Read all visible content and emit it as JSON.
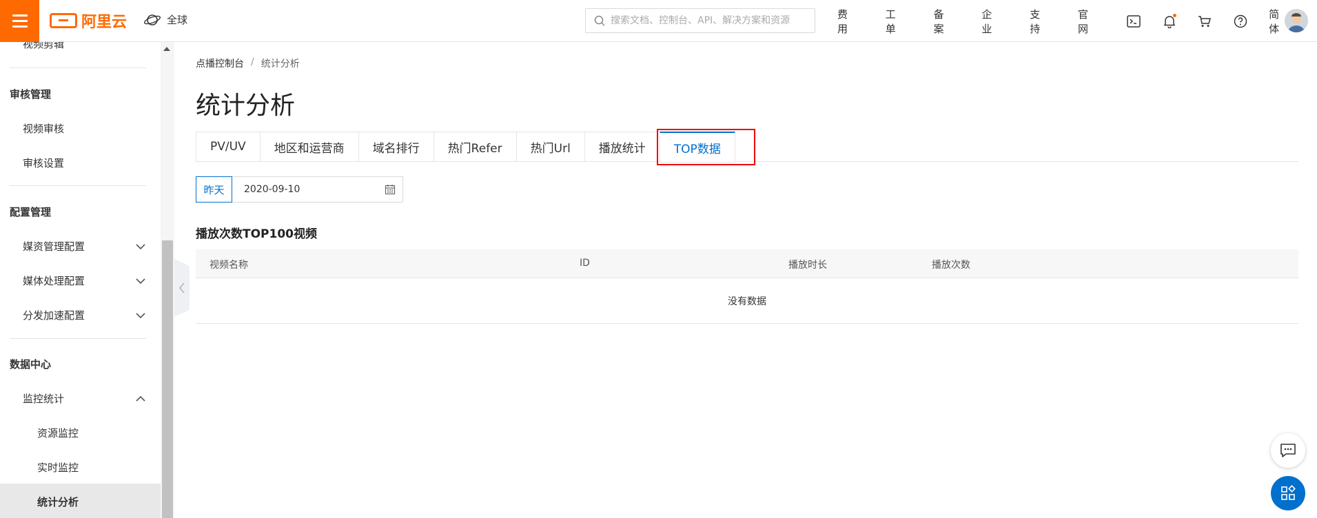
{
  "topbar": {
    "logo_text": "阿里云",
    "region": "全球",
    "search_placeholder": "搜索文档、控制台、API、解决方案和资源",
    "nav": [
      "费用",
      "工单",
      "备案",
      "企业",
      "支持",
      "官网"
    ],
    "lang": "简体",
    "accent": "#ff6a00"
  },
  "sidebar": {
    "partial_top": "视频剪辑",
    "groups": [
      {
        "title": "审核管理",
        "items": [
          "视频审核",
          "审核设置"
        ]
      },
      {
        "title": "配置管理",
        "items": [
          "媒资管理配置",
          "媒体处理配置",
          "分发加速配置"
        ]
      },
      {
        "title": "数据中心",
        "items": [
          "监控统计"
        ],
        "subitems": [
          "资源监控",
          "实时监控",
          "统计分析"
        ]
      }
    ],
    "active_item": "统计分析"
  },
  "main": {
    "breadcrumb": {
      "root": "点播控制台",
      "separator": "/",
      "current": "统计分析"
    },
    "title": "统计分析",
    "tabs": [
      "PV/UV",
      "地区和运营商",
      "域名排行",
      "热门Refer",
      "热门Url",
      "播放统计",
      "TOP数据"
    ],
    "active_tab": "TOP数据",
    "date": {
      "quick_label": "昨天",
      "value": "2020-09-10"
    },
    "section_title": "播放次数TOP100视频",
    "table": {
      "columns": [
        "视频名称",
        "ID",
        "播放时长",
        "播放次数"
      ],
      "empty_text": "没有数据"
    },
    "primary_color": "#0070cc",
    "highlight_color": "#e00000"
  }
}
